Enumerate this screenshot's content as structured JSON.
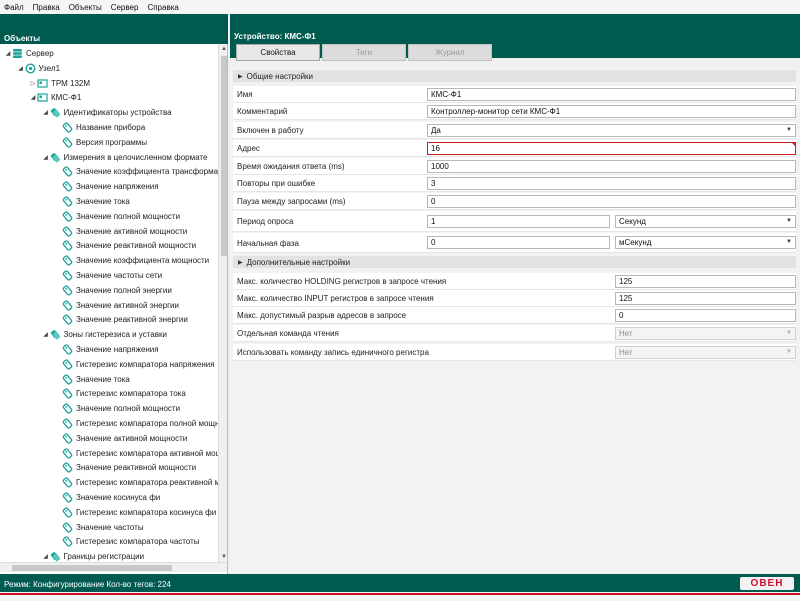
{
  "menu": [
    "Файл",
    "Правка",
    "Объекты",
    "Сервер",
    "Справка"
  ],
  "left_title": "Объекты",
  "tree": [
    {
      "label": "Сервер",
      "level": 0,
      "icon": "server",
      "expanded": true
    },
    {
      "label": "Узел1",
      "level": 1,
      "icon": "node",
      "expanded": true
    },
    {
      "label": "ТРМ 132М",
      "level": 2,
      "icon": "device",
      "expanded": false
    },
    {
      "label": "КМС-Ф1",
      "level": 2,
      "icon": "device",
      "expanded": true
    },
    {
      "label": "Идентификаторы устройства",
      "level": 3,
      "icon": "group",
      "expanded": true
    },
    {
      "label": "Название прибора",
      "level": 4,
      "icon": "tag"
    },
    {
      "label": "Версия программы",
      "level": 4,
      "icon": "tag"
    },
    {
      "label": "Измерения в целочисленном формате",
      "level": 3,
      "icon": "group",
      "expanded": true
    },
    {
      "label": "Значение коэффициента трансформации",
      "level": 4,
      "icon": "tag"
    },
    {
      "label": "Значение напряжения",
      "level": 4,
      "icon": "tag"
    },
    {
      "label": "Значение тока",
      "level": 4,
      "icon": "tag"
    },
    {
      "label": "Значение полной мощности",
      "level": 4,
      "icon": "tag"
    },
    {
      "label": "Значение активной мощности",
      "level": 4,
      "icon": "tag"
    },
    {
      "label": "Значение реактивной мощности",
      "level": 4,
      "icon": "tag"
    },
    {
      "label": "Значение коэффициента мощности",
      "level": 4,
      "icon": "tag"
    },
    {
      "label": "Значение частоты сети",
      "level": 4,
      "icon": "tag"
    },
    {
      "label": "Значение полной энергии",
      "level": 4,
      "icon": "tag"
    },
    {
      "label": "Значение активной энергии",
      "level": 4,
      "icon": "tag"
    },
    {
      "label": "Значение реактивной энергии",
      "level": 4,
      "icon": "tag"
    },
    {
      "label": "Зоны гистерезиса и уставки",
      "level": 3,
      "icon": "group",
      "expanded": true
    },
    {
      "label": "Значение напряжения",
      "level": 4,
      "icon": "tag"
    },
    {
      "label": "Гистерезис компаратора напряжения",
      "level": 4,
      "icon": "tag"
    },
    {
      "label": "Значение тока",
      "level": 4,
      "icon": "tag"
    },
    {
      "label": "Гистерезис компаратора тока",
      "level": 4,
      "icon": "tag"
    },
    {
      "label": "Значение полной мощности",
      "level": 4,
      "icon": "tag"
    },
    {
      "label": "Гистерезис компаратора полной мощности",
      "level": 4,
      "icon": "tag"
    },
    {
      "label": "Значение активной мощности",
      "level": 4,
      "icon": "tag"
    },
    {
      "label": "Гистерезис компаратора активной мощности",
      "level": 4,
      "icon": "tag"
    },
    {
      "label": "Значение реактивной мощности",
      "level": 4,
      "icon": "tag"
    },
    {
      "label": "Гистерезис компаратора реактивной мощности",
      "level": 4,
      "icon": "tag"
    },
    {
      "label": "Значение косинуса фи",
      "level": 4,
      "icon": "tag"
    },
    {
      "label": "Гистерезис компаратора косинуса фи",
      "level": 4,
      "icon": "tag"
    },
    {
      "label": "Значение частоты",
      "level": 4,
      "icon": "tag"
    },
    {
      "label": "Гистерезис компаратора частоты",
      "level": 4,
      "icon": "tag"
    },
    {
      "label": "Границы регистрации",
      "level": 3,
      "icon": "group",
      "expanded": true
    }
  ],
  "right_title": "Устройство: КМС-Ф1",
  "tabs": [
    {
      "label": "Свойства",
      "active": true
    },
    {
      "label": "Теги",
      "active": false
    },
    {
      "label": "Журнал",
      "active": false
    }
  ],
  "general": {
    "header": "Общие настройки",
    "name_label": "Имя",
    "name_value": "КМС-Ф1",
    "comment_label": "Комментарий",
    "comment_value": "Контроллер-монитор сети КМС-Ф1",
    "enabled_label": "Включен в работу",
    "enabled_value": "Да",
    "address_label": "Адрес",
    "address_value": "16",
    "timeout_label": "Время ожидания ответа (ms)",
    "timeout_value": "1000",
    "retries_label": "Повторы при ошибке",
    "retries_value": "3",
    "pause_label": "Пауза между запросами (ms)",
    "pause_value": "0",
    "period_label": "Период опроса",
    "period_value": "1",
    "period_unit": "Секунд",
    "phase_label": "Начальная фаза",
    "phase_value": "0",
    "phase_unit": "мСекунд"
  },
  "advanced": {
    "header": "Дополнительные настройки",
    "holding_label": "Макс. количество HOLDING регистров в запросе чтения",
    "holding_value": "125",
    "input_label": "Макс. количество INPUT регистров в запросе чтения",
    "input_value": "125",
    "gap_label": "Макс. допустимый разрыв адресов в запросе",
    "gap_value": "0",
    "separate_read_label": "Отдельная команда чтения",
    "separate_read_value": "Нет",
    "single_write_label": "Использовать команду запись единичного регистра",
    "single_write_value": "Нет"
  },
  "status": {
    "text": "Режим: Конфигурирование  Кол-во тегов: 224",
    "logo": "ОВЕН"
  },
  "colors": {
    "header_bg": "#005a50",
    "error_border": "#c81e1e",
    "brand_red": "#c8102e"
  }
}
